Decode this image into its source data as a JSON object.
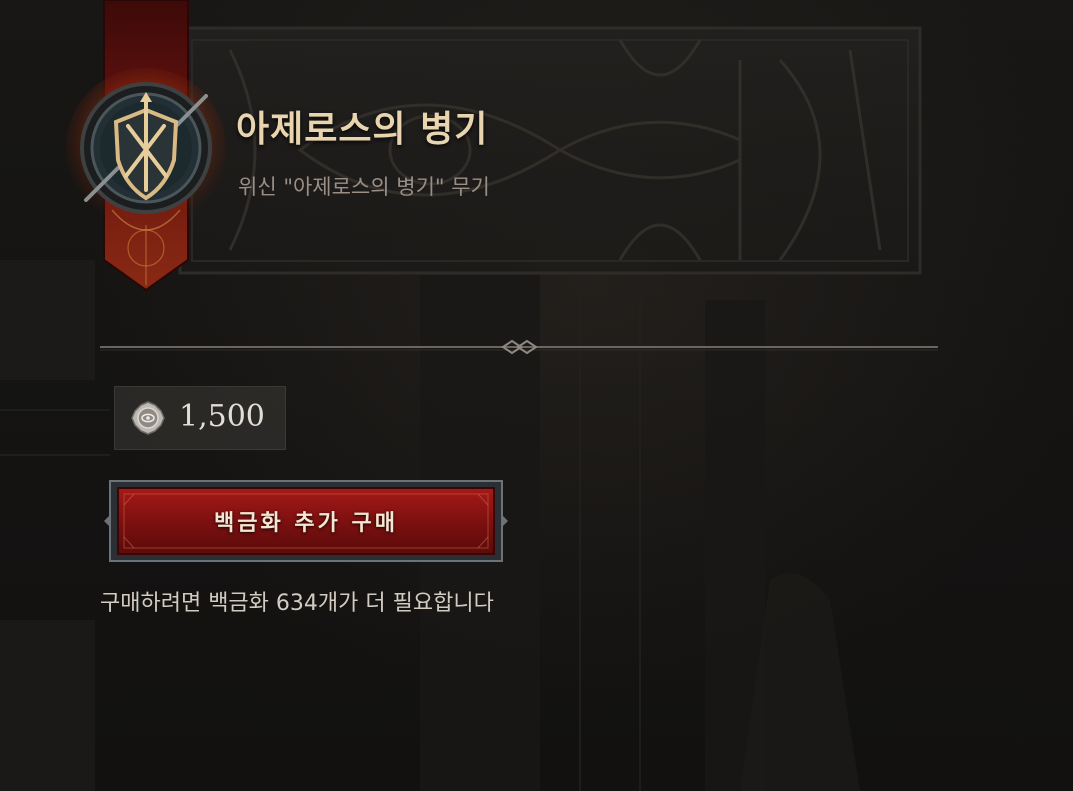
{
  "item": {
    "title": "아제로스의 병기",
    "subtitle": "위신 \"아제로스의 병기\" 무기",
    "icon": "shield-crossed-swords-emblem"
  },
  "price": {
    "currency_icon": "platinum-coin-icon",
    "value": "1,500"
  },
  "purchase_button": {
    "label": "백금화 추가 구매"
  },
  "requirement": {
    "text": "구매하려면 백금화 634개가 더 필요합니다"
  },
  "colors": {
    "title": "#e8d4ae",
    "button_red": "#8c1414",
    "banner_red": "#6a1410",
    "accent_gold": "#d9b984"
  }
}
